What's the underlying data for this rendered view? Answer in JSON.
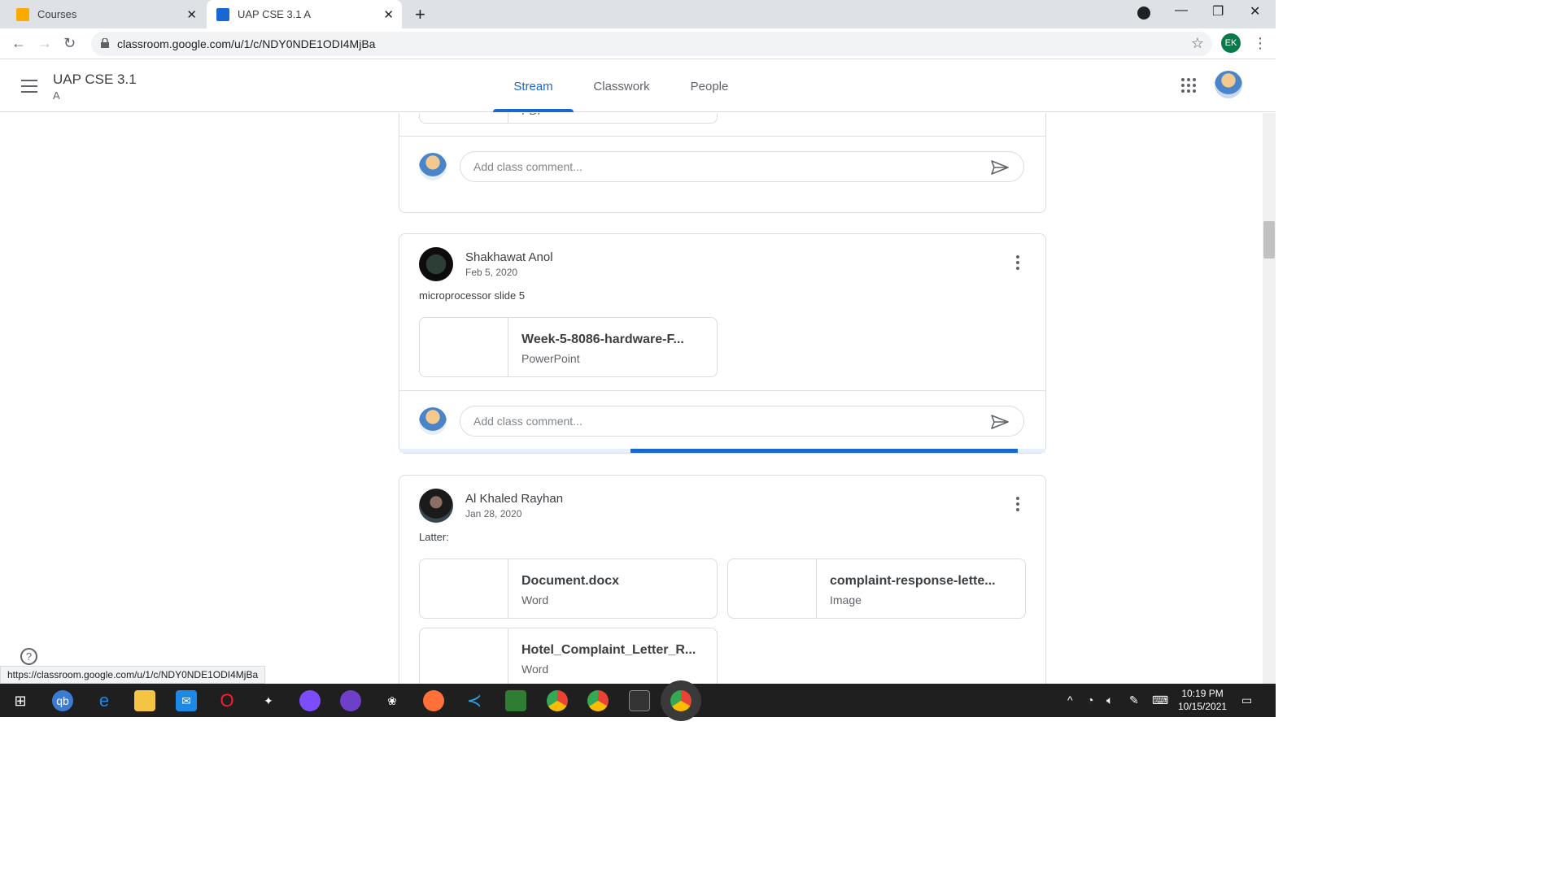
{
  "browser": {
    "tabs": [
      {
        "title": "Courses",
        "favicon_color": "#f9ab00"
      },
      {
        "title": "UAP CSE 3.1 A",
        "favicon_color": "#1967d2"
      }
    ],
    "url": "classroom.google.com/u/1/c/NDY0NDE1ODI4MjBa",
    "profile_initials": "EK",
    "status_url": "https://classroom.google.com/u/1/c/NDY0NDE1ODI4MjBa"
  },
  "appbar": {
    "title": "UAP CSE 3.1",
    "section": "A",
    "nav": [
      "Stream",
      "Classwork",
      "People"
    ],
    "active_nav": "Stream"
  },
  "stream": {
    "partial_card": {
      "attachment_type": "PDF",
      "comment_placeholder": "Add class comment..."
    },
    "posts": [
      {
        "author": "Shakhawat Anol",
        "date": "Feb 5, 2020",
        "text": "microprocessor slide 5",
        "attachments": [
          {
            "name": "Week-5-8086-hardware-F...",
            "type": "PowerPoint"
          }
        ],
        "comment_placeholder": "Add class comment..."
      },
      {
        "author": "Al Khaled Rayhan",
        "date": "Jan 28, 2020",
        "text": "Latter:",
        "attachments": [
          {
            "name": "Document.docx",
            "type": "Word"
          },
          {
            "name": "complaint-response-lette...",
            "type": "Image"
          },
          {
            "name": "Hotel_Complaint_Letter_R...",
            "type": "Word"
          }
        ]
      }
    ]
  },
  "taskbar": {
    "time": "10:19 PM",
    "date": "10/15/2021"
  },
  "colors": {
    "accent": "#1967d2",
    "border": "#dadce0",
    "taskbar": "#1f1f1f"
  }
}
